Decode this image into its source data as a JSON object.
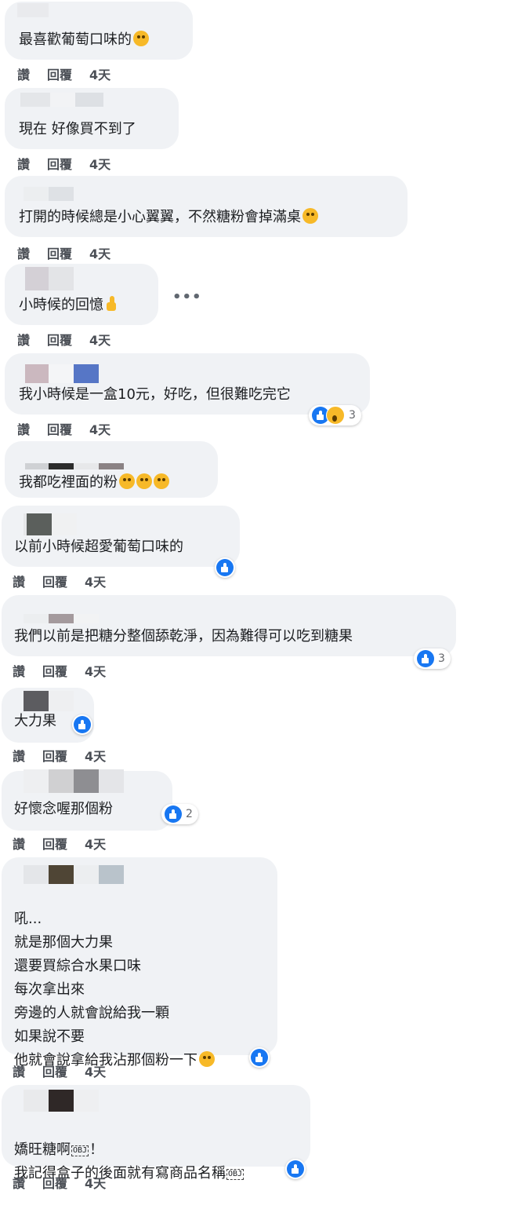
{
  "actions": {
    "like": "讚",
    "reply": "回覆",
    "time": "4天"
  },
  "more_label": "•••",
  "comments": [
    {
      "lines": [
        "最喜歡葡萄口味的"
      ],
      "emoji": "grin-sweat-emoji"
    },
    {
      "lines": [
        "現在 好像買不到了"
      ]
    },
    {
      "lines": [
        "打開的時候總是小心翼翼，不然糖粉會掉滿桌"
      ],
      "emoji": "squint-tongue-emoji"
    },
    {
      "lines": [
        "小時候的回憶"
      ],
      "emoji": "thumbs-up-emoji"
    },
    {
      "lines": [
        "我小時候是一盒10元，好吃，但很難吃完它"
      ],
      "reactions": {
        "icons": [
          "like-icon",
          "wow-icon"
        ],
        "count": "3"
      }
    },
    {
      "lines": [
        "我都吃裡面的粉"
      ],
      "emoji": "rofl-emoji x3"
    },
    {
      "lines": [
        "以前小時候超愛葡萄口味的"
      ],
      "reactions": {
        "icons": [
          "like-icon"
        ],
        "count": ""
      }
    },
    {
      "lines": [
        "我們以前是把糖分整個舔乾淨，因為難得可以吃到糖果"
      ],
      "reactions": {
        "icons": [
          "like-icon"
        ],
        "count": "3"
      }
    },
    {
      "lines": [
        "大力果"
      ],
      "reactions": {
        "icons": [
          "like-icon"
        ],
        "count": ""
      }
    },
    {
      "lines": [
        "好懷念喔那個粉"
      ],
      "reactions": {
        "icons": [
          "like-icon"
        ],
        "count": "2"
      }
    },
    {
      "lines": [
        "吼...",
        "就是那個大力果",
        "還要買綜合水果口味",
        "每次拿出來",
        "旁邊的人就會說給我一顆",
        "如果說不要",
        "他就會說拿給我沾那個粉一下"
      ],
      "emoji": "rofl-emoji",
      "reactions": {
        "icons": [
          "like-icon"
        ],
        "count": ""
      }
    },
    {
      "lines": [
        "嬌旺糖啊",
        "我記得盒子的後面就有寫商品名稱"
      ],
      "obj": "OBJ",
      "exclaim": "！",
      "reactions": {
        "icons": [
          "like-icon"
        ],
        "count": ""
      }
    }
  ]
}
